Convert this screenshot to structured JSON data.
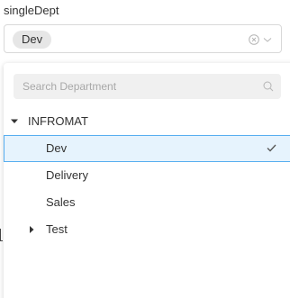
{
  "field": {
    "label": "singleDept",
    "selected_tag": "Dev"
  },
  "dropdown": {
    "search_placeholder": "Search Department",
    "tree": [
      {
        "label": "INFROMAT",
        "expanded": true,
        "level": 0
      },
      {
        "label": "Dev",
        "selected": true,
        "level": 1
      },
      {
        "label": "Delivery",
        "level": 1
      },
      {
        "label": "Sales",
        "level": 1
      },
      {
        "label": "Test",
        "expanded": false,
        "level": 1
      }
    ]
  },
  "colors": {
    "selected_row_bg": "#e6f3fd",
    "selected_row_border": "#57aef0",
    "tag_bg": "#e6e6e6",
    "search_bg": "#f0f0f0"
  },
  "icons": {
    "clear": "circle-x-icon",
    "chevron": "chevron-down-icon",
    "search": "search-icon",
    "expand": "caret-down-icon",
    "collapse": "caret-right-icon",
    "check": "check-icon"
  }
}
